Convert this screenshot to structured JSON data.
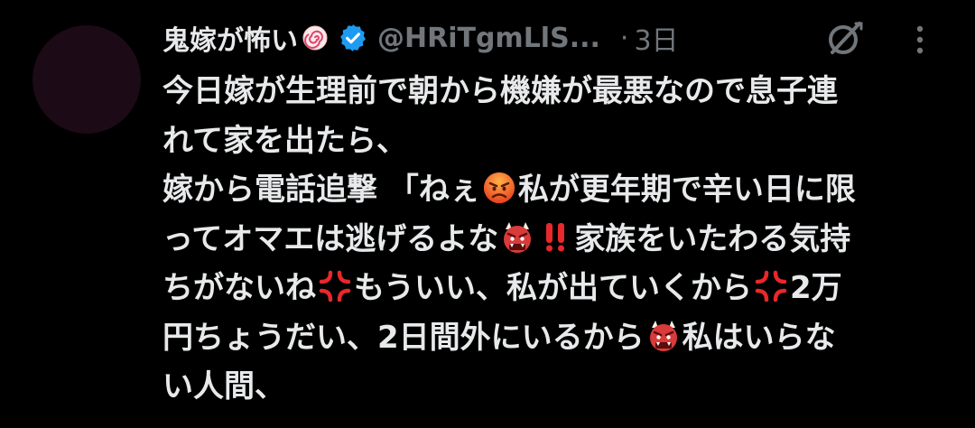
{
  "author": {
    "display_name": "鬼嫁が怖い",
    "name_emoji": "fish-cake-swirl-icon",
    "verified": "verified-badge-icon",
    "handle": "@HRiTgmLlS...",
    "separator": "·",
    "time": "3日"
  },
  "tweet": {
    "lines": [
      [
        "今日嫁が生理前で朝から機嫌が最悪なので息子連"
      ],
      [
        "れて家を出たら、"
      ],
      [
        "嫁から電話追撃 「ねぇ",
        "私が更年期で辛い日に限"
      ],
      [
        "ってオマエは逃げるよな",
        "家族をいたわる気持"
      ],
      [
        "ちがないね",
        "もういい、私が出ていくから",
        "2万"
      ],
      [
        "円ちょうだい、2日間外にいるから",
        "私はいらな"
      ],
      [
        "い人間、"
      ]
    ]
  },
  "icons": {
    "grok": "grok-icon",
    "more": "more-icon",
    "angry_face": "angry-face-icon",
    "ogre": "ogre-icon",
    "double_exclamation": "double-exclamation-icon",
    "anger_symbol": "anger-symbol-icon"
  },
  "colors": {
    "background": "#000000",
    "text": "#e7e9ea",
    "secondary": "#71767b",
    "verified": "#1d9bf0",
    "avatar": "#1c0a16"
  }
}
